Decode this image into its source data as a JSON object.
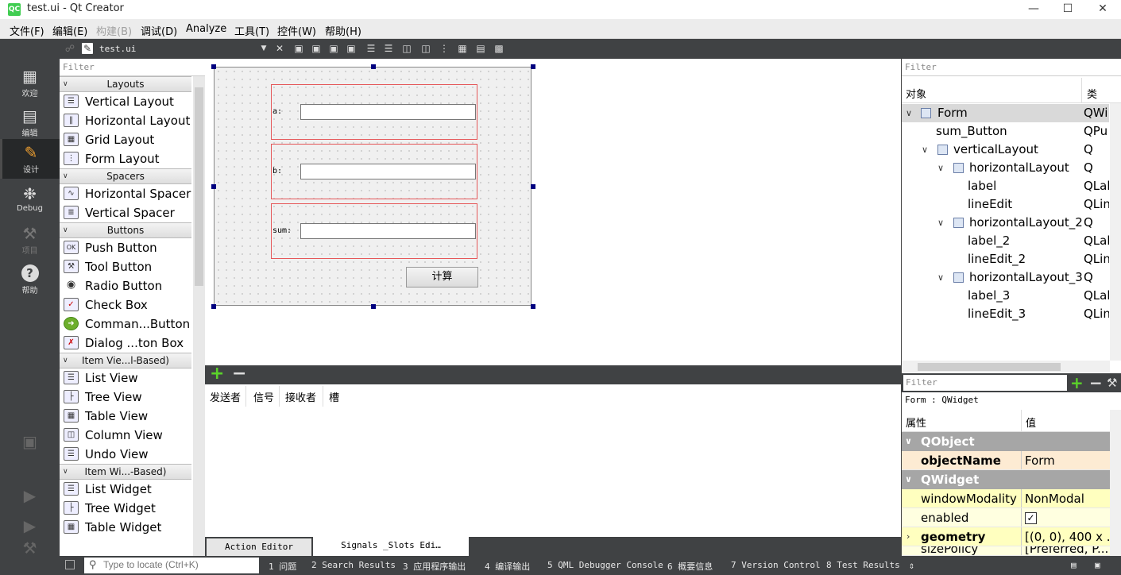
{
  "window": {
    "title": "test.ui - Qt Creator",
    "app_icon": "QC"
  },
  "menu": [
    "文件(F)",
    "编辑(E)",
    "构建(B)",
    "调试(D)",
    "Analyze",
    "工具(T)",
    "控件(W)",
    "帮助(H)"
  ],
  "modes": [
    {
      "label": "欢迎",
      "icon": "grid-icon"
    },
    {
      "label": "编辑",
      "icon": "document-icon"
    },
    {
      "label": "设计",
      "icon": "pencil-icon"
    },
    {
      "label": "Debug",
      "icon": "bug-icon"
    },
    {
      "label": "项目",
      "icon": "wrench-icon"
    },
    {
      "label": "帮助",
      "icon": "help-icon"
    }
  ],
  "editor": {
    "filename": "test.ui"
  },
  "widgetbox": {
    "filter_placeholder": "Filter",
    "categories": [
      {
        "name": "Layouts",
        "items": [
          "Vertical Layout",
          "Horizontal Layout",
          "Grid Layout",
          "Form Layout"
        ]
      },
      {
        "name": "Spacers",
        "items": [
          "Horizontal Spacer",
          "Vertical Spacer"
        ]
      },
      {
        "name": "Buttons",
        "items": [
          "Push Button",
          "Tool Button",
          "Radio Button",
          "Check Box",
          "Comman...Button",
          "Dialog ...ton Box"
        ]
      },
      {
        "name": "Item Vie...l-Based)",
        "items": [
          "List View",
          "Tree View",
          "Table View",
          "Column View",
          "Undo View"
        ]
      },
      {
        "name": "Item Wi...-Based)",
        "items": [
          "List Widget",
          "Tree Widget",
          "Table Widget"
        ]
      }
    ]
  },
  "form": {
    "rows": [
      {
        "label": "a:"
      },
      {
        "label": "b:"
      },
      {
        "label": "sum:"
      }
    ],
    "button": "计算"
  },
  "signals": {
    "headers": [
      "发送者",
      "信号",
      "接收者",
      "槽"
    ]
  },
  "bottom_tabs": [
    "Action Editor",
    "Signals _Slots Edi…"
  ],
  "object_inspector": {
    "filter_placeholder": "Filter",
    "headers": [
      "对象",
      "类"
    ],
    "rows": [
      {
        "name": "Form",
        "cls": "QWi"
      },
      {
        "name": "sum_Button",
        "cls": "QPu"
      },
      {
        "name": "verticalLayout",
        "cls": "Q"
      },
      {
        "name": "horizontalLayout",
        "cls": "Q"
      },
      {
        "name": "label",
        "cls": "QLab"
      },
      {
        "name": "lineEdit",
        "cls": "QLin"
      },
      {
        "name": "horizontalLayout_2",
        "cls": "Q"
      },
      {
        "name": "label_2",
        "cls": "QLab"
      },
      {
        "name": "lineEdit_2",
        "cls": "QLin"
      },
      {
        "name": "horizontalLayout_3",
        "cls": "Q"
      },
      {
        "name": "label_3",
        "cls": "QLab"
      },
      {
        "name": "lineEdit_3",
        "cls": "QLin"
      }
    ]
  },
  "property_editor": {
    "filter_placeholder": "Filter",
    "object_line": "Form : QWidget",
    "headers": [
      "属性",
      "值"
    ],
    "groups": [
      {
        "name": "QObject",
        "props": [
          {
            "name": "objectName",
            "value": "Form"
          }
        ]
      },
      {
        "name": "QWidget",
        "props": [
          {
            "name": "windowModality",
            "value": "NonModal"
          },
          {
            "name": "enabled",
            "value": "✓"
          },
          {
            "name": "geometry",
            "value": "[(0, 0), 400 x ..."
          },
          {
            "name": "sizePolicy",
            "value": "[Preferred, P..."
          }
        ]
      }
    ]
  },
  "statusbar": {
    "locate_placeholder": "Type to locate (Ctrl+K)",
    "tabs": [
      "1 问题",
      "2 Search Results",
      "3 应用程序输出",
      "4 编译输出",
      "5 QML Debugger Console",
      "6 概要信息",
      "7 Version Control",
      "8 Test Results"
    ]
  }
}
